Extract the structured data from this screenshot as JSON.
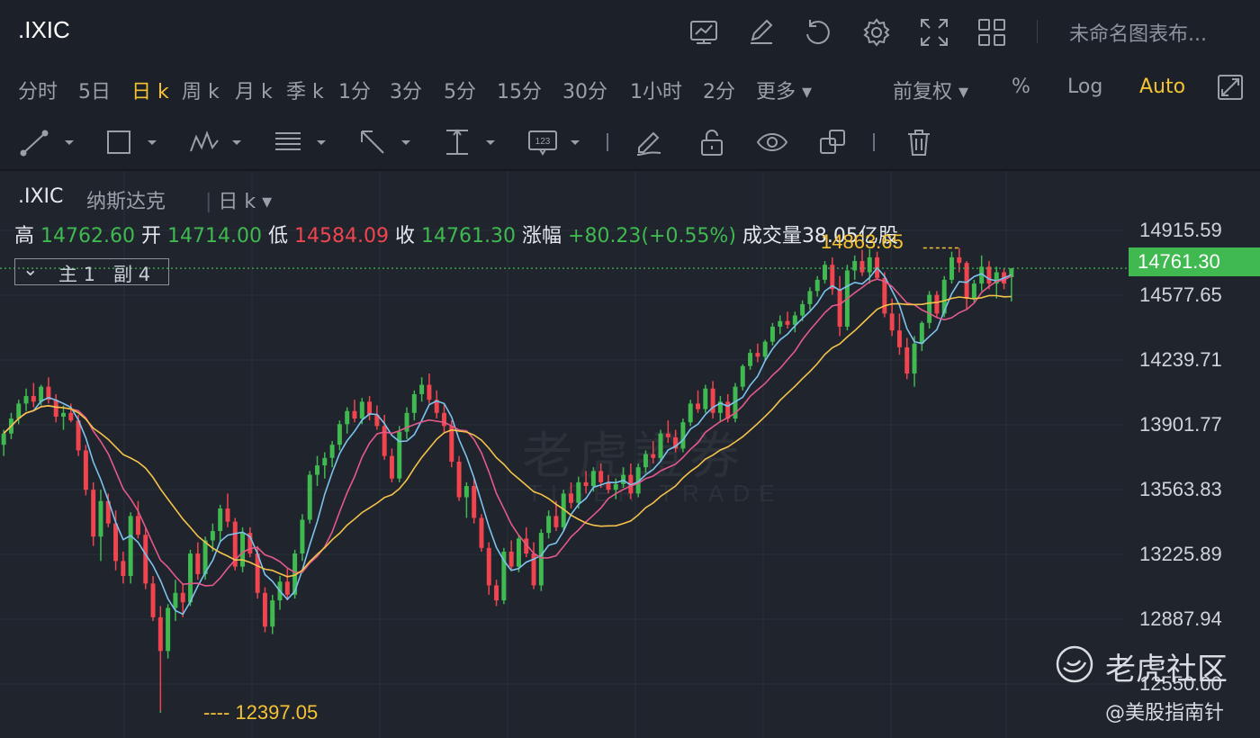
{
  "app": {
    "symbol": ".IXIC",
    "layout_name": "未命名图表布...",
    "icons": [
      "monitor-chart-icon",
      "pencil-edit-icon",
      "undo-icon",
      "gear-icon",
      "fullscreen-icon",
      "grid-layout-icon"
    ]
  },
  "periods": [
    {
      "label": "分时",
      "active": false
    },
    {
      "label": "5日",
      "active": false
    },
    {
      "label": "日 k",
      "active": true
    },
    {
      "label": "周 k",
      "active": false
    },
    {
      "label": "月 k",
      "active": false
    },
    {
      "label": "季 k",
      "active": false
    },
    {
      "label": "1分",
      "active": false
    },
    {
      "label": "3分",
      "active": false
    },
    {
      "label": "5分",
      "active": false
    },
    {
      "label": "15分",
      "active": false
    },
    {
      "label": "30分",
      "active": false
    },
    {
      "label": "1小时",
      "active": false
    },
    {
      "label": "2分",
      "active": false
    },
    {
      "label": "更多 ▾",
      "active": false
    }
  ],
  "options": {
    "adjust": "前复权 ▾",
    "percent": "%",
    "log": "Log",
    "auto": "Auto"
  },
  "drawing_tools": [
    "line-tool-icon",
    "rectangle-tool-icon",
    "pattern-tool-icon",
    "fibonacci-tool-icon",
    "arrow-tool-icon",
    "measure-tool-icon",
    "price-label-tool-icon",
    "brush-icon",
    "lock-icon",
    "eye-icon",
    "clone-icon",
    "trash-icon"
  ],
  "chart_header": {
    "symbol": ".IXIC",
    "name": "纳斯达克",
    "period": "日 k ▾",
    "high_label": "高",
    "high": "14762.60",
    "open_label": "开",
    "open": "14714.00",
    "low_label": "低",
    "low": "14584.09",
    "close_label": "收",
    "close": "14761.30",
    "change_label": "涨幅",
    "change": "+80.23(+0.55%)",
    "volume_label": "成交量",
    "volume": "38.05亿股",
    "indicator_toggle": "主 1   副 4"
  },
  "price_axis": [
    "14915.59",
    "14577.65",
    "14239.71",
    "13901.77",
    "13563.83",
    "13225.89",
    "12887.94",
    "12550.00"
  ],
  "last_price": "14761.30",
  "annotations": {
    "min_label": "---- 12397.05",
    "max_label": "14863.65"
  },
  "watermark": {
    "brand": "老虎社区",
    "author": "@美股指南针",
    "background_cn": "老虎證券",
    "background_en": "TIGER TRADE"
  },
  "colors": {
    "up": "#3fb950",
    "down": "#f0454f",
    "active": "#f5c332",
    "ma5": "#7cc3ee",
    "ma10": "#e35a8a",
    "ma20": "#f5c34a"
  },
  "chart_data": {
    "type": "candlestick",
    "y_range": [
      12400,
      15050
    ],
    "candles": [
      {
        "o": 13820,
        "h": 13900,
        "l": 13760,
        "c": 13880
      },
      {
        "o": 13880,
        "h": 13990,
        "l": 13850,
        "c": 13960
      },
      {
        "o": 13960,
        "h": 14060,
        "l": 13930,
        "c": 14040
      },
      {
        "o": 14040,
        "h": 14120,
        "l": 14000,
        "c": 14080
      },
      {
        "o": 14080,
        "h": 14150,
        "l": 14020,
        "c": 14050
      },
      {
        "o": 14050,
        "h": 14140,
        "l": 14030,
        "c": 14130
      },
      {
        "o": 14130,
        "h": 14180,
        "l": 14040,
        "c": 14060
      },
      {
        "o": 14060,
        "h": 14090,
        "l": 13940,
        "c": 13970
      },
      {
        "o": 13970,
        "h": 14030,
        "l": 13900,
        "c": 13990
      },
      {
        "o": 13990,
        "h": 14040,
        "l": 13940,
        "c": 13950
      },
      {
        "o": 13950,
        "h": 13980,
        "l": 13760,
        "c": 13790
      },
      {
        "o": 13790,
        "h": 13820,
        "l": 13550,
        "c": 13580
      },
      {
        "o": 13580,
        "h": 13620,
        "l": 13280,
        "c": 13330
      },
      {
        "o": 13330,
        "h": 13580,
        "l": 13200,
        "c": 13520
      },
      {
        "o": 13520,
        "h": 13560,
        "l": 13380,
        "c": 13400
      },
      {
        "o": 13400,
        "h": 13470,
        "l": 13150,
        "c": 13200
      },
      {
        "o": 13200,
        "h": 13250,
        "l": 13080,
        "c": 13120
      },
      {
        "o": 13120,
        "h": 13460,
        "l": 13080,
        "c": 13440
      },
      {
        "o": 13440,
        "h": 13520,
        "l": 13320,
        "c": 13340
      },
      {
        "o": 13340,
        "h": 13380,
        "l": 13050,
        "c": 13080
      },
      {
        "o": 13080,
        "h": 13120,
        "l": 12880,
        "c": 12900
      },
      {
        "o": 12900,
        "h": 12960,
        "l": 12400,
        "c": 12720
      },
      {
        "o": 12720,
        "h": 12970,
        "l": 12680,
        "c": 12950
      },
      {
        "o": 12950,
        "h": 13100,
        "l": 12880,
        "c": 13030
      },
      {
        "o": 13030,
        "h": 13080,
        "l": 12900,
        "c": 12980
      },
      {
        "o": 12980,
        "h": 13260,
        "l": 12960,
        "c": 13240
      },
      {
        "o": 13240,
        "h": 13300,
        "l": 13100,
        "c": 13130
      },
      {
        "o": 13130,
        "h": 13330,
        "l": 13100,
        "c": 13310
      },
      {
        "o": 13310,
        "h": 13400,
        "l": 13250,
        "c": 13360
      },
      {
        "o": 13360,
        "h": 13500,
        "l": 13300,
        "c": 13480
      },
      {
        "o": 13480,
        "h": 13560,
        "l": 13380,
        "c": 13410
      },
      {
        "o": 13410,
        "h": 13430,
        "l": 13150,
        "c": 13170
      },
      {
        "o": 13170,
        "h": 13380,
        "l": 13140,
        "c": 13350
      },
      {
        "o": 13350,
        "h": 13380,
        "l": 13220,
        "c": 13240
      },
      {
        "o": 13240,
        "h": 13280,
        "l": 13000,
        "c": 13030
      },
      {
        "o": 13030,
        "h": 13060,
        "l": 12820,
        "c": 12850
      },
      {
        "o": 12850,
        "h": 13020,
        "l": 12810,
        "c": 12990
      },
      {
        "o": 12990,
        "h": 13120,
        "l": 12940,
        "c": 13090
      },
      {
        "o": 13090,
        "h": 13160,
        "l": 12990,
        "c": 13020
      },
      {
        "o": 13020,
        "h": 13260,
        "l": 13000,
        "c": 13240
      },
      {
        "o": 13240,
        "h": 13450,
        "l": 13200,
        "c": 13420
      },
      {
        "o": 13420,
        "h": 13680,
        "l": 13400,
        "c": 13660
      },
      {
        "o": 13660,
        "h": 13760,
        "l": 13600,
        "c": 13710
      },
      {
        "o": 13710,
        "h": 13780,
        "l": 13640,
        "c": 13750
      },
      {
        "o": 13750,
        "h": 13840,
        "l": 13700,
        "c": 13820
      },
      {
        "o": 13820,
        "h": 13950,
        "l": 13790,
        "c": 13930
      },
      {
        "o": 13930,
        "h": 14020,
        "l": 13880,
        "c": 14000
      },
      {
        "o": 14000,
        "h": 14060,
        "l": 13940,
        "c": 13960
      },
      {
        "o": 13960,
        "h": 14070,
        "l": 13930,
        "c": 14050
      },
      {
        "o": 14050,
        "h": 14080,
        "l": 13950,
        "c": 13980
      },
      {
        "o": 13980,
        "h": 14030,
        "l": 13900,
        "c": 13920
      },
      {
        "o": 13920,
        "h": 13980,
        "l": 13740,
        "c": 13760
      },
      {
        "o": 13760,
        "h": 13800,
        "l": 13620,
        "c": 13640
      },
      {
        "o": 13640,
        "h": 13920,
        "l": 13620,
        "c": 13890
      },
      {
        "o": 13890,
        "h": 14020,
        "l": 13850,
        "c": 13990
      },
      {
        "o": 13990,
        "h": 14110,
        "l": 13950,
        "c": 14090
      },
      {
        "o": 14090,
        "h": 14180,
        "l": 14050,
        "c": 14140
      },
      {
        "o": 14140,
        "h": 14200,
        "l": 14040,
        "c": 14060
      },
      {
        "o": 14060,
        "h": 14110,
        "l": 13960,
        "c": 13990
      },
      {
        "o": 13990,
        "h": 14040,
        "l": 13880,
        "c": 13920
      },
      {
        "o": 13920,
        "h": 13950,
        "l": 13700,
        "c": 13730
      },
      {
        "o": 13730,
        "h": 13760,
        "l": 13520,
        "c": 13540
      },
      {
        "o": 13540,
        "h": 13620,
        "l": 13430,
        "c": 13600
      },
      {
        "o": 13600,
        "h": 13640,
        "l": 13400,
        "c": 13430
      },
      {
        "o": 13430,
        "h": 13450,
        "l": 13250,
        "c": 13270
      },
      {
        "o": 13270,
        "h": 13300,
        "l": 13020,
        "c": 13070
      },
      {
        "o": 13070,
        "h": 13100,
        "l": 12960,
        "c": 12990
      },
      {
        "o": 12990,
        "h": 13270,
        "l": 12970,
        "c": 13250
      },
      {
        "o": 13250,
        "h": 13310,
        "l": 13150,
        "c": 13170
      },
      {
        "o": 13170,
        "h": 13340,
        "l": 13140,
        "c": 13320
      },
      {
        "o": 13320,
        "h": 13380,
        "l": 13220,
        "c": 13240
      },
      {
        "o": 13240,
        "h": 13300,
        "l": 13050,
        "c": 13070
      },
      {
        "o": 13070,
        "h": 13370,
        "l": 13040,
        "c": 13350
      },
      {
        "o": 13350,
        "h": 13470,
        "l": 13320,
        "c": 13440
      },
      {
        "o": 13440,
        "h": 13520,
        "l": 13360,
        "c": 13380
      },
      {
        "o": 13380,
        "h": 13580,
        "l": 13360,
        "c": 13560
      },
      {
        "o": 13560,
        "h": 13620,
        "l": 13480,
        "c": 13510
      },
      {
        "o": 13510,
        "h": 13650,
        "l": 13480,
        "c": 13620
      },
      {
        "o": 13620,
        "h": 13680,
        "l": 13560,
        "c": 13600
      },
      {
        "o": 13600,
        "h": 13700,
        "l": 13570,
        "c": 13680
      },
      {
        "o": 13680,
        "h": 13720,
        "l": 13590,
        "c": 13620
      },
      {
        "o": 13620,
        "h": 13660,
        "l": 13560,
        "c": 13580
      },
      {
        "o": 13580,
        "h": 13640,
        "l": 13530,
        "c": 13610
      },
      {
        "o": 13610,
        "h": 13700,
        "l": 13590,
        "c": 13660
      },
      {
        "o": 13660,
        "h": 13720,
        "l": 13530,
        "c": 13560
      },
      {
        "o": 13560,
        "h": 13720,
        "l": 13540,
        "c": 13700
      },
      {
        "o": 13700,
        "h": 13790,
        "l": 13670,
        "c": 13770
      },
      {
        "o": 13770,
        "h": 13840,
        "l": 13720,
        "c": 13750
      },
      {
        "o": 13750,
        "h": 13900,
        "l": 13730,
        "c": 13880
      },
      {
        "o": 13880,
        "h": 13950,
        "l": 13830,
        "c": 13860
      },
      {
        "o": 13860,
        "h": 13900,
        "l": 13780,
        "c": 13800
      },
      {
        "o": 13800,
        "h": 13960,
        "l": 13780,
        "c": 13940
      },
      {
        "o": 13940,
        "h": 14060,
        "l": 13920,
        "c": 14040
      },
      {
        "o": 14040,
        "h": 14110,
        "l": 13990,
        "c": 14010
      },
      {
        "o": 14010,
        "h": 14140,
        "l": 13990,
        "c": 14120
      },
      {
        "o": 14120,
        "h": 14160,
        "l": 13960,
        "c": 13990
      },
      {
        "o": 13990,
        "h": 14080,
        "l": 13940,
        "c": 14050
      },
      {
        "o": 14050,
        "h": 14090,
        "l": 13940,
        "c": 13960
      },
      {
        "o": 13960,
        "h": 14150,
        "l": 13940,
        "c": 14130
      },
      {
        "o": 14130,
        "h": 14250,
        "l": 14110,
        "c": 14240
      },
      {
        "o": 14240,
        "h": 14330,
        "l": 14220,
        "c": 14310
      },
      {
        "o": 14310,
        "h": 14360,
        "l": 14260,
        "c": 14290
      },
      {
        "o": 14290,
        "h": 14380,
        "l": 14270,
        "c": 14370
      },
      {
        "o": 14370,
        "h": 14470,
        "l": 14350,
        "c": 14450
      },
      {
        "o": 14450,
        "h": 14510,
        "l": 14410,
        "c": 14480
      },
      {
        "o": 14480,
        "h": 14530,
        "l": 14440,
        "c": 14460
      },
      {
        "o": 14460,
        "h": 14530,
        "l": 14420,
        "c": 14510
      },
      {
        "o": 14510,
        "h": 14590,
        "l": 14480,
        "c": 14570
      },
      {
        "o": 14570,
        "h": 14660,
        "l": 14540,
        "c": 14640
      },
      {
        "o": 14640,
        "h": 14720,
        "l": 14610,
        "c": 14700
      },
      {
        "o": 14700,
        "h": 14800,
        "l": 14680,
        "c": 14780
      },
      {
        "o": 14780,
        "h": 14820,
        "l": 14620,
        "c": 14650
      },
      {
        "o": 14650,
        "h": 14720,
        "l": 14400,
        "c": 14450
      },
      {
        "o": 14450,
        "h": 14780,
        "l": 14430,
        "c": 14750
      },
      {
        "o": 14750,
        "h": 14830,
        "l": 14700,
        "c": 14800
      },
      {
        "o": 14800,
        "h": 14860,
        "l": 14720,
        "c": 14740
      },
      {
        "o": 14740,
        "h": 14864,
        "l": 14680,
        "c": 14820
      },
      {
        "o": 14820,
        "h": 14850,
        "l": 14700,
        "c": 14710
      },
      {
        "o": 14710,
        "h": 14740,
        "l": 14500,
        "c": 14520
      },
      {
        "o": 14520,
        "h": 14600,
        "l": 14400,
        "c": 14430
      },
      {
        "o": 14430,
        "h": 14520,
        "l": 14300,
        "c": 14340
      },
      {
        "o": 14340,
        "h": 14390,
        "l": 14170,
        "c": 14200
      },
      {
        "o": 14200,
        "h": 14400,
        "l": 14130,
        "c": 14360
      },
      {
        "o": 14360,
        "h": 14480,
        "l": 14320,
        "c": 14470
      },
      {
        "o": 14470,
        "h": 14640,
        "l": 14440,
        "c": 14620
      },
      {
        "o": 14620,
        "h": 14640,
        "l": 14500,
        "c": 14520
      },
      {
        "o": 14520,
        "h": 14720,
        "l": 14500,
        "c": 14700
      },
      {
        "o": 14700,
        "h": 14850,
        "l": 14680,
        "c": 14820
      },
      {
        "o": 14820,
        "h": 14870,
        "l": 14740,
        "c": 14790
      },
      {
        "o": 14790,
        "h": 14800,
        "l": 14540,
        "c": 14600
      },
      {
        "o": 14600,
        "h": 14700,
        "l": 14580,
        "c": 14680
      },
      {
        "o": 14680,
        "h": 14830,
        "l": 14640,
        "c": 14770
      },
      {
        "o": 14770,
        "h": 14800,
        "l": 14650,
        "c": 14680
      },
      {
        "o": 14680,
        "h": 14770,
        "l": 14600,
        "c": 14740
      },
      {
        "o": 14740,
        "h": 14760,
        "l": 14650,
        "c": 14680
      },
      {
        "o": 14714,
        "h": 14762.6,
        "l": 14584.09,
        "c": 14761.3
      }
    ]
  }
}
